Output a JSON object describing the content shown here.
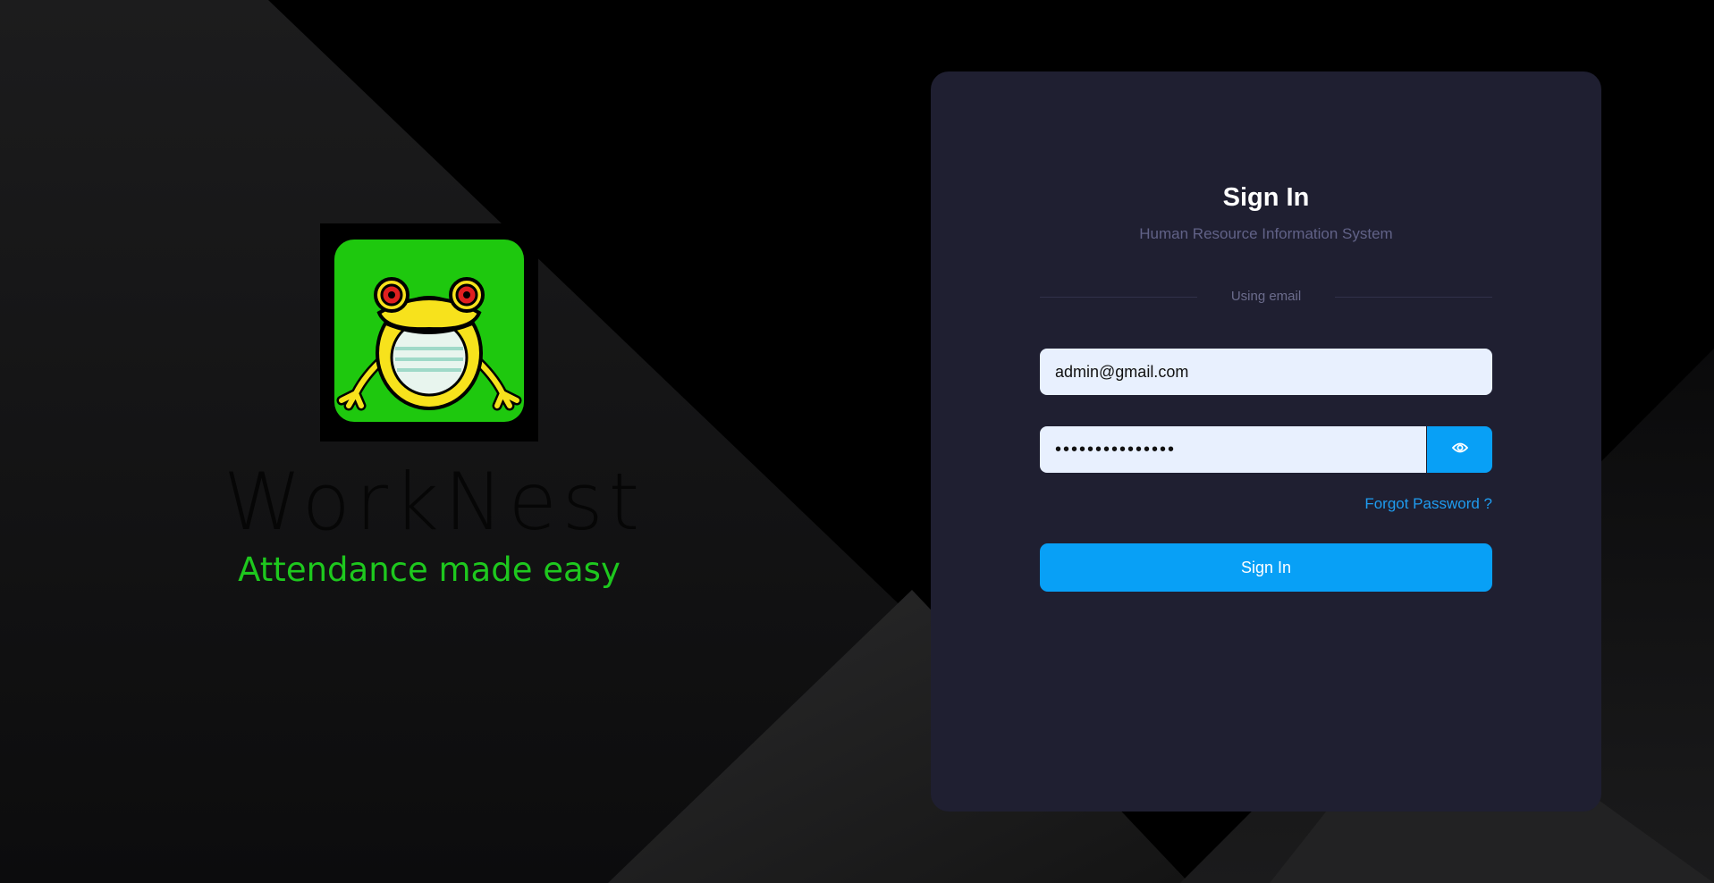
{
  "brand": {
    "wordmark": "WorkNest",
    "tagline": "Attendance made easy"
  },
  "signin": {
    "title": "Sign In",
    "subtitle": "Human Resource Information System",
    "divider_label": "Using email",
    "email_value": "admin@gmail.com",
    "password_value": "•••••••••••••••",
    "forgot_link": "Forgot Password ?",
    "submit_label": "Sign In"
  },
  "colors": {
    "card_bg": "#1f1f31",
    "accent": "#08a0f6",
    "link": "#1f9cf0",
    "tagline": "#1ec81e",
    "logo_green": "#1ec80e"
  },
  "icons": {
    "logo": "frog-logo-icon",
    "show_password": "eye-icon"
  }
}
